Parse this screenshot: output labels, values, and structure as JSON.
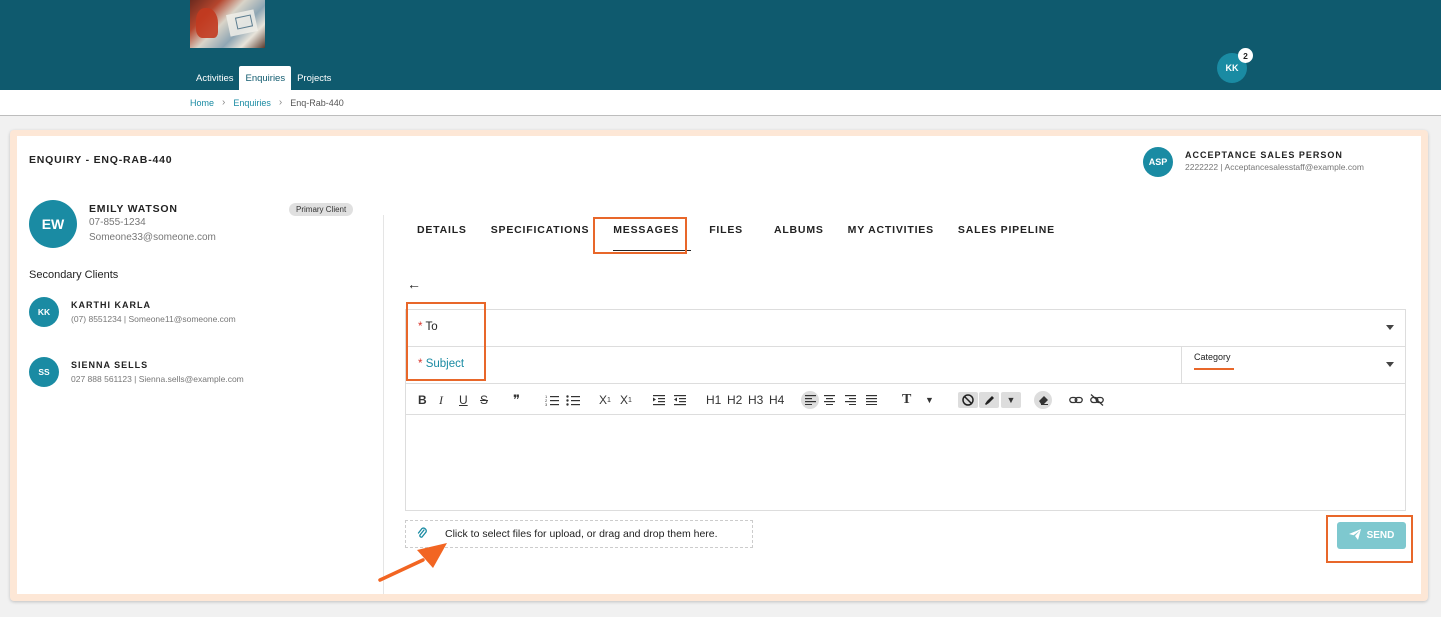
{
  "nav": {
    "tabs": [
      "Activities",
      "Enquiries",
      "Projects"
    ],
    "active_tab": "Enquiries"
  },
  "user": {
    "initials": "KK",
    "notifications": "2"
  },
  "breadcrumb": {
    "home": "Home",
    "section": "Enquiries",
    "current": "Enq-Rab-440"
  },
  "enquiry": {
    "title": "ENQUIRY - ENQ-RAB-440"
  },
  "sales_person": {
    "initials": "ASP",
    "name": "ACCEPTANCE SALES PERSON",
    "contact": "2222222  |  Acceptancesalesstaff@example.com"
  },
  "primary_client": {
    "initials": "EW",
    "name": "EMILY WATSON",
    "phone": "07-855-1234",
    "email": "Someone33@someone.com",
    "badge": "Primary Client"
  },
  "secondary_clients": {
    "title": "Secondary Clients",
    "items": [
      {
        "initials": "KK",
        "name": "KARTHI KARLA",
        "contact": "(07) 8551234  |  Someone11@someone.com"
      },
      {
        "initials": "SS",
        "name": "SIENNA SELLS",
        "contact": "027 888 561123  |  Sienna.sells@example.com"
      }
    ]
  },
  "tabs": [
    "DETAILS",
    "SPECIFICATIONS",
    "MESSAGES",
    "FILES",
    "ALBUMS",
    "MY ACTIVITIES",
    "SALES PIPELINE"
  ],
  "active_tab": "MESSAGES",
  "form": {
    "to_label": "To",
    "subject_label": "Subject",
    "category_label": "Category",
    "required_marker": "*"
  },
  "toolbar": {
    "bold": "B",
    "italic": "I",
    "underline": "U",
    "strike": "S",
    "quote": "❞",
    "h1": "H1",
    "h2": "H2",
    "h3": "H3",
    "h4": "H4",
    "text": "T"
  },
  "upload": {
    "text": "Click to select files for upload, or drag and drop them here."
  },
  "send": {
    "label": "SEND"
  },
  "colors": {
    "brand": "#0f5a6e",
    "accent": "#1a8ba3",
    "highlight": "#e8672a"
  }
}
